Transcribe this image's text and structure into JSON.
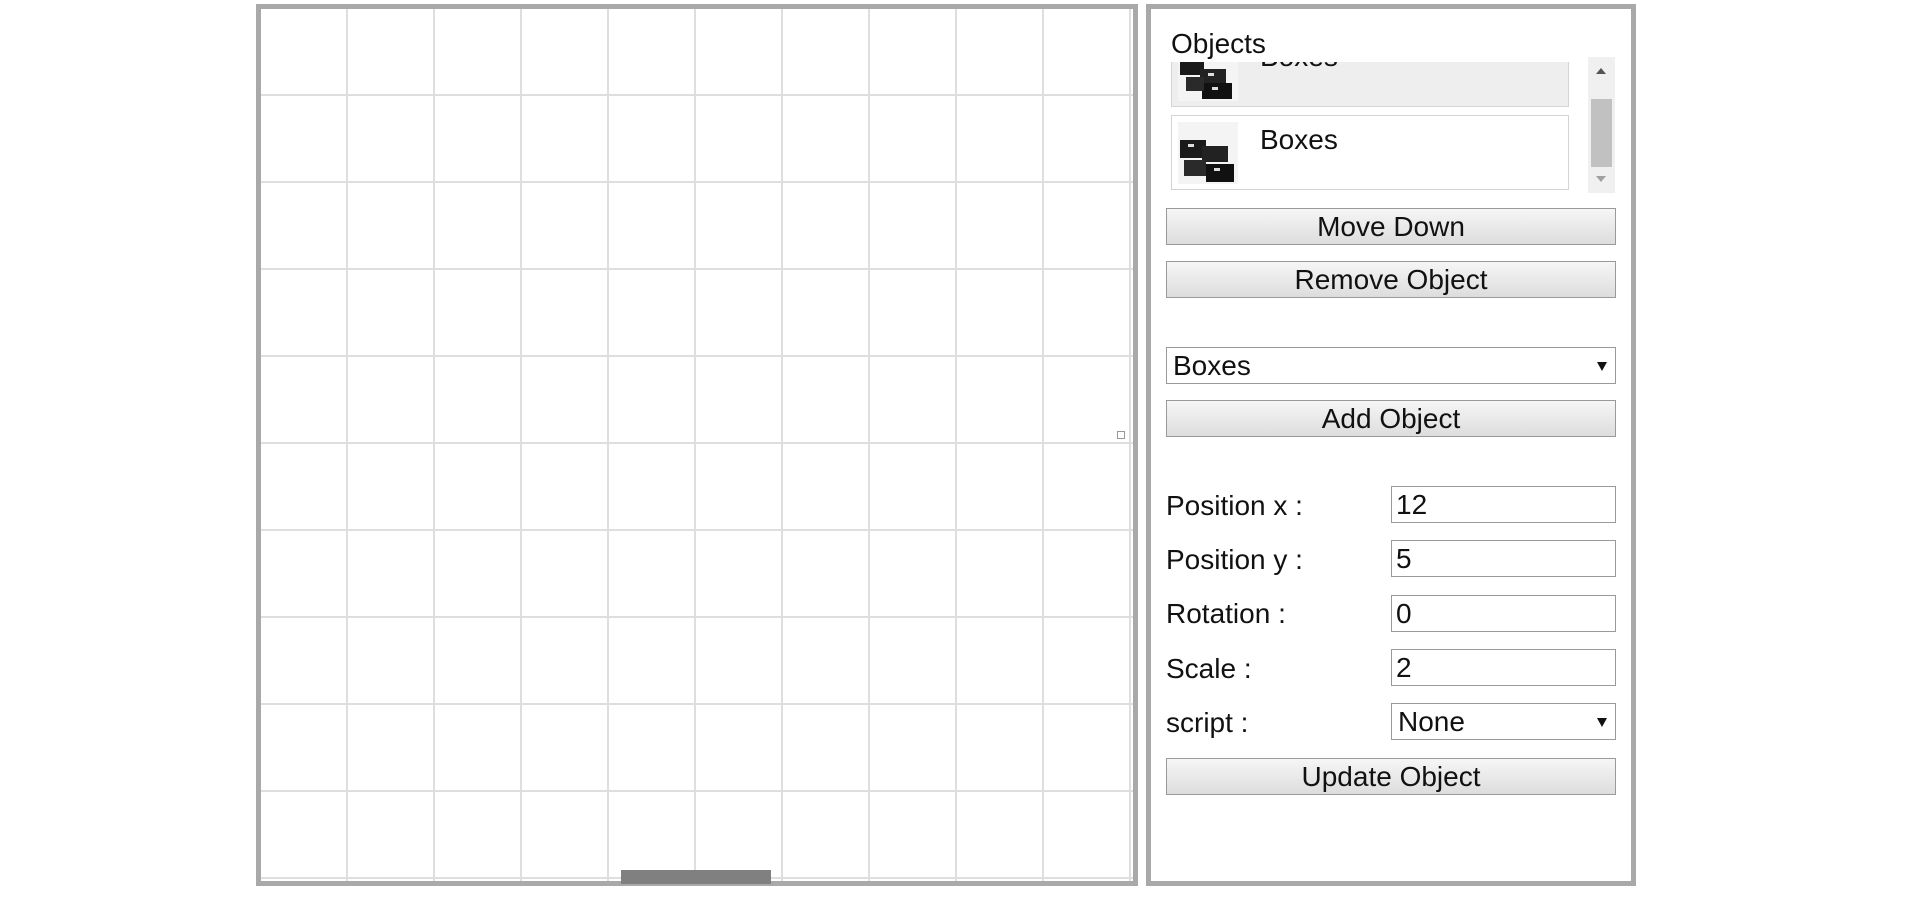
{
  "objects_panel": {
    "title": "Objects",
    "items": [
      {
        "label": "Boxes",
        "selected": true,
        "icon": "boxes-thumbnail"
      },
      {
        "label": "Boxes",
        "selected": false,
        "icon": "boxes-thumbnail"
      }
    ]
  },
  "buttons": {
    "move_down": "Move Down",
    "remove_object": "Remove Object",
    "add_object": "Add Object",
    "update_object": "Update Object"
  },
  "object_type_select": {
    "value": "Boxes"
  },
  "properties": {
    "position_x": {
      "label": "Position x :",
      "value": "12"
    },
    "position_y": {
      "label": "Position y :",
      "value": "5"
    },
    "rotation": {
      "label": "Rotation :",
      "value": "0"
    },
    "scale": {
      "label": "Scale :",
      "value": "2"
    },
    "script": {
      "label": "script :",
      "value": "None"
    }
  },
  "colors": {
    "border": "#a9a9a9",
    "grid": "#dedede",
    "button_top": "#f6f6f6",
    "button_bottom": "#dddddd"
  }
}
